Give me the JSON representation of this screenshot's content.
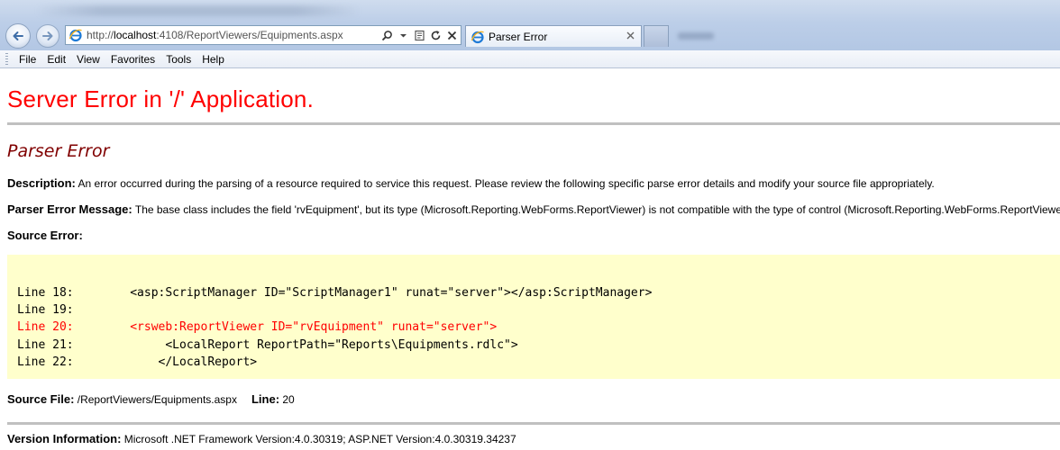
{
  "browser": {
    "url_prefix": "http://",
    "url_host": "localhost",
    "url_path": ":4108/ReportViewers/Equipments.aspx",
    "tab_title": "Parser Error",
    "menu": [
      "File",
      "Edit",
      "View",
      "Favorites",
      "Tools",
      "Help"
    ],
    "icons": [
      "back-arrow-icon",
      "forward-arrow-icon",
      "ie-logo-icon",
      "search-icon",
      "compatibility-view-icon",
      "refresh-icon",
      "stop-icon",
      "close-tab-icon"
    ]
  },
  "page": {
    "title": "Server Error in '/' Application.",
    "subtitle": "Parser Error",
    "description_label": "Description:",
    "description_text": " An error occurred during the parsing of a resource required to service this request. Please review the following specific parse error details and modify your source file appropriately.",
    "message_label": "Parser Error Message:",
    "message_text": " The base class includes the field 'rvEquipment', but its type (Microsoft.Reporting.WebForms.ReportViewer) is not compatible with the type of control (Microsoft.Reporting.WebForms.ReportViewer).",
    "source_error_label": "Source Error:",
    "code_lines": [
      {
        "text": "Line 18:        <asp:ScriptManager ID=\"ScriptManager1\" runat=\"server\"></asp:ScriptManager>",
        "error": false
      },
      {
        "text": "Line 19:",
        "error": false
      },
      {
        "text": "Line 20:        <rsweb:ReportViewer ID=\"rvEquipment\" runat=\"server\">",
        "error": true
      },
      {
        "text": "Line 21:             <LocalReport ReportPath=\"Reports\\Equipments.rdlc\">",
        "error": false
      },
      {
        "text": "Line 22:            </LocalReport>",
        "error": false
      }
    ],
    "source_file_label": "Source File:",
    "source_file_value": " /ReportViewers/Equipments.aspx",
    "line_label": "Line:",
    "line_value": " 20",
    "version_label": "Version Information:",
    "version_text": " Microsoft .NET Framework Version:4.0.30319; ASP.NET Version:4.0.30319.34237"
  },
  "colors": {
    "title_red": "#ff0000",
    "subtitle_maroon": "#800000",
    "code_background": "#ffffcc",
    "error_line": "#ff0000"
  }
}
